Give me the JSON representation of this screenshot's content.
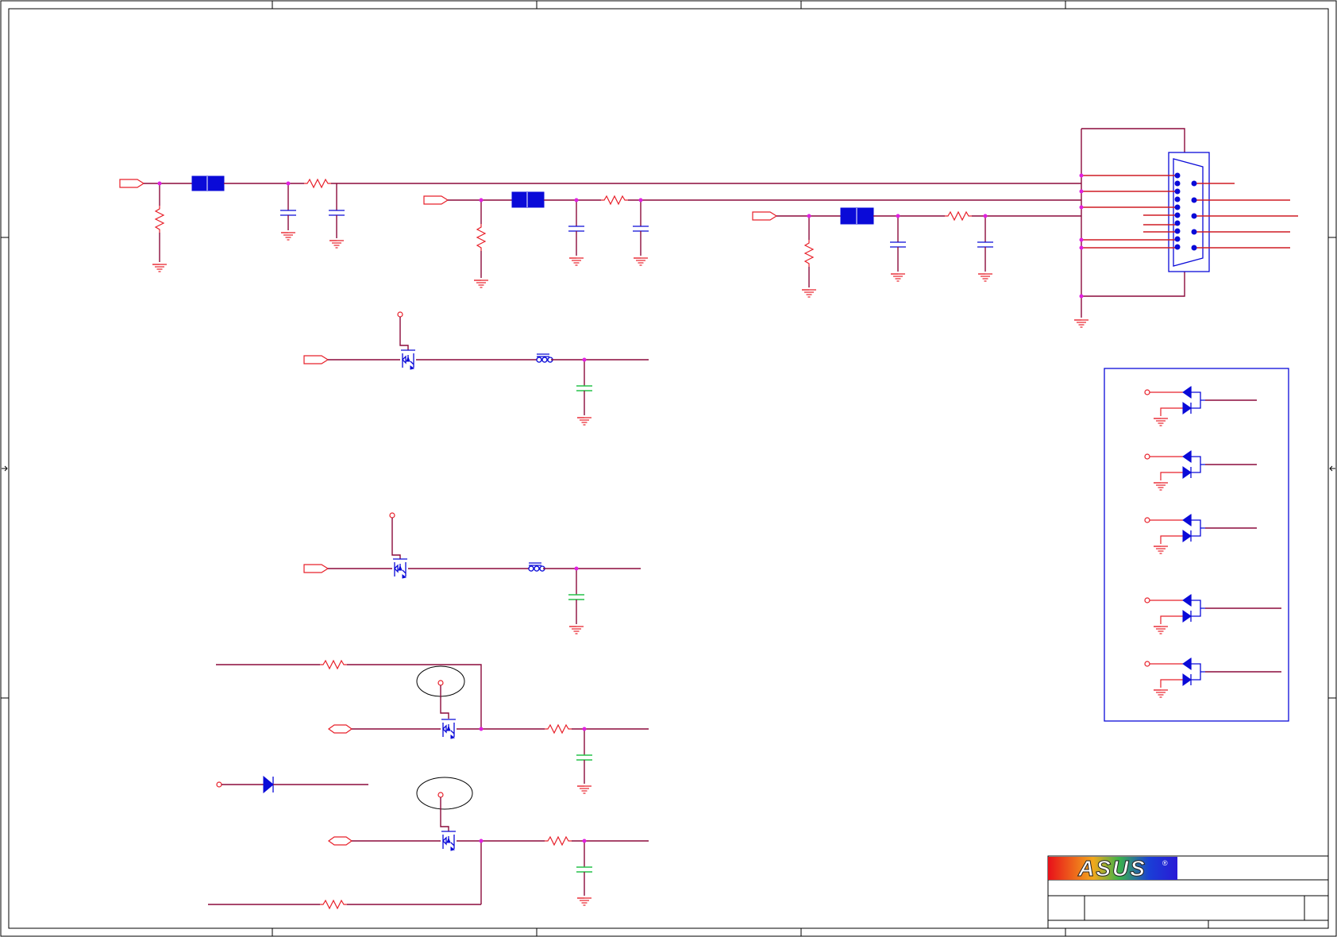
{
  "title_block": {
    "logo_text": "ASUS",
    "logo_mark": "®"
  },
  "colors": {
    "wire": "#8b0a3c",
    "component": "#e8202a",
    "device": "#0a0ad8",
    "capacitor_highlight": "#27c24a",
    "junction": "#e020e0"
  }
}
